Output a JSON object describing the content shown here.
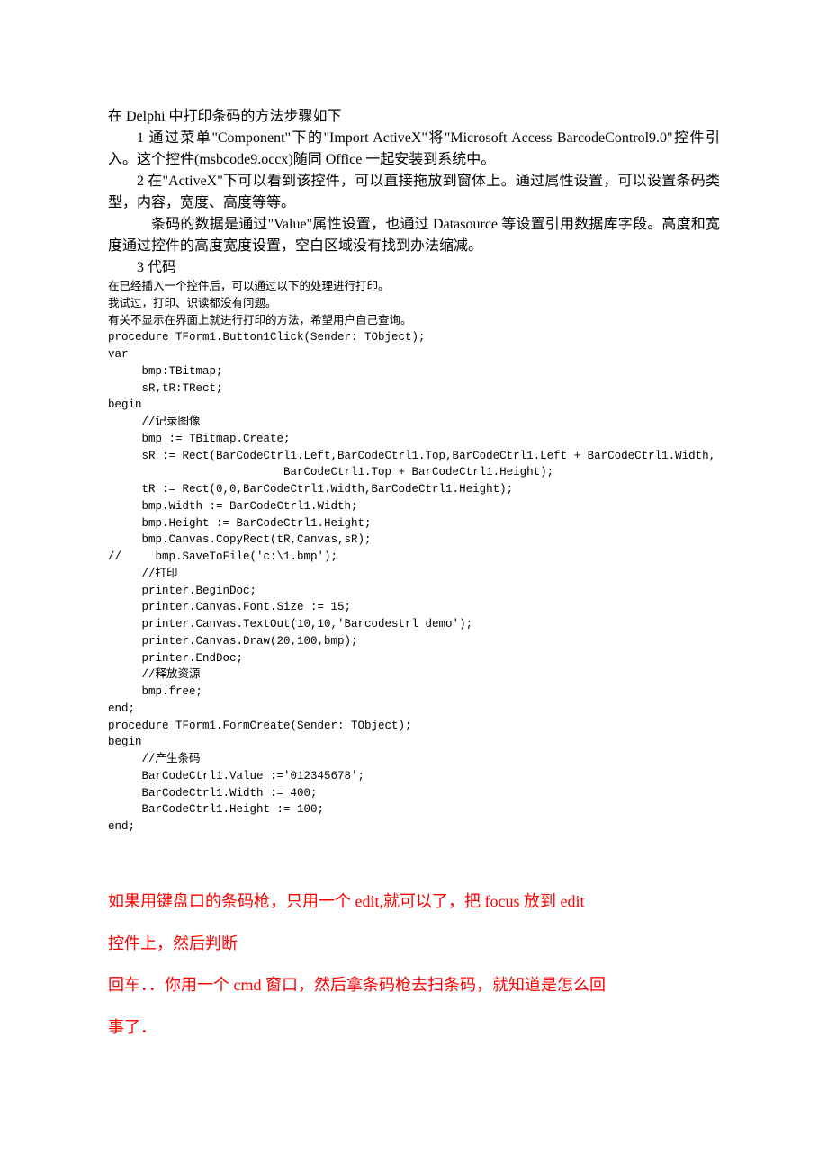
{
  "paragraphs": {
    "p0": "在 Delphi 中打印条码的方法步骤如下",
    "p1": "1 通过菜单\"Component\"下的\"Import ActiveX\"将\"Microsoft Access BarcodeControl9.0\"控件引入。这个控件(msbcode9.occx)随同 Office 一起安装到系统中。",
    "p2": "2 在\"ActiveX\"下可以看到该控件，可以直接拖放到窗体上。通过属性设置，可以设置条码类型，内容，宽度、高度等等。",
    "p3": "条码的数据是通过\"Value\"属性设置，也通过 Datasource 等设置引用数据库字段。高度和宽度通过控件的高度宽度设置，空白区域没有找到办法缩减。",
    "p4": "3 代码"
  },
  "code": {
    "l1": "在已经插入一个控件后，可以通过以下的处理进行打印。",
    "l2": "我试过，打印、识读都没有问题。",
    "l3": "有关不显示在界面上就进行打印的方法，希望用户自己查询。",
    "l4": "procedure TForm1.Button1Click(Sender: TObject);",
    "l5": "var",
    "l6": "     bmp:TBitmap;",
    "l7": "     sR,tR:TRect;",
    "l8": "begin",
    "l9": "     //记录图像",
    "l10": "     bmp := TBitmap.Create;",
    "l11": "     sR := Rect(BarCodeCtrl1.Left,BarCodeCtrl1.Top,BarCodeCtrl1.Left + BarCodeCtrl1.Width,",
    "l12": "                          BarCodeCtrl1.Top + BarCodeCtrl1.Height);",
    "l13": "     tR := Rect(0,0,BarCodeCtrl1.Width,BarCodeCtrl1.Height);",
    "l14": "     bmp.Width := BarCodeCtrl1.Width;",
    "l15": "     bmp.Height := BarCodeCtrl1.Height;",
    "l16": "     bmp.Canvas.CopyRect(tR,Canvas,sR);",
    "l17": "//     bmp.SaveToFile('c:\\1.bmp');",
    "l18": "     //打印",
    "l19": "     printer.BeginDoc;",
    "l20": "     printer.Canvas.Font.Size := 15;",
    "l21": "     printer.Canvas.TextOut(10,10,'Barcodestrl demo');",
    "l22": "     printer.Canvas.Draw(20,100,bmp);",
    "l23": "     printer.EndDoc;",
    "l24": "     //释放资源",
    "l25": "     bmp.free;",
    "l26": "end;",
    "l27": "procedure TForm1.FormCreate(Sender: TObject);",
    "l28": "begin",
    "l29": "     //产生条码",
    "l30": "     BarCodeCtrl1.Value :='012345678';",
    "l31": "     BarCodeCtrl1.Width := 400;",
    "l32": "     BarCodeCtrl1.Height := 100;",
    "l33": "end;"
  },
  "red": {
    "r1a": "如果用键盘口的条码枪，只用一个 ",
    "r1b": "edit,",
    "r1c": "就可以了，把 ",
    "r1d": "focus ",
    "r1e": "放到 ",
    "r1f": "edit ",
    "r2a": "控件上，然后判断",
    "r3a": "回车．．你用一个 ",
    "r3b": "cmd ",
    "r3c": "窗口，然后拿条码枪去扫条码，就知道是怎么回",
    "r4a": "事了．"
  }
}
